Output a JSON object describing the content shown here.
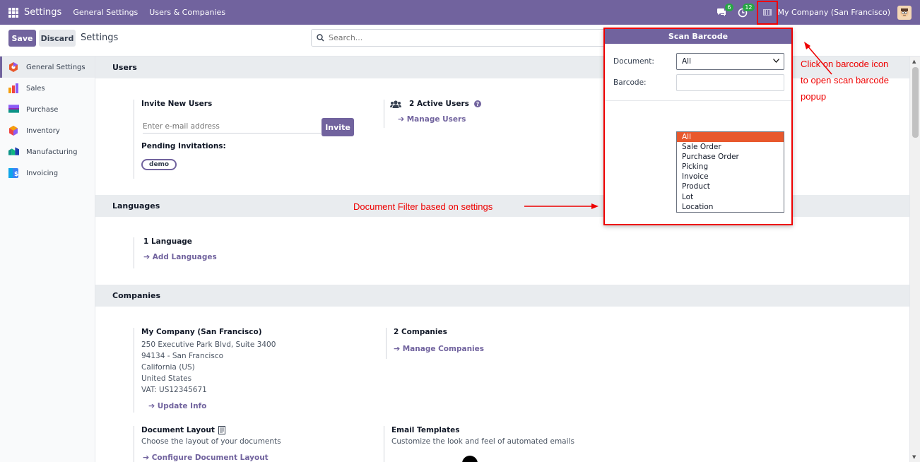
{
  "topbar": {
    "brand": "Settings",
    "nav": [
      "General Settings",
      "Users & Companies"
    ],
    "chat_badge": "6",
    "activity_badge": "12",
    "company": "My Company (San Francisco)"
  },
  "controlbar": {
    "save": "Save",
    "discard": "Discard",
    "title": "Settings",
    "search_placeholder": "Search..."
  },
  "sidebar": {
    "items": [
      {
        "label": "General Settings",
        "color": "#e8582c"
      },
      {
        "label": "Sales",
        "color": "#f59e0b"
      },
      {
        "label": "Purchase",
        "color": "#8b5cf6"
      },
      {
        "label": "Inventory",
        "color": "#ef4444"
      },
      {
        "label": "Manufacturing",
        "color": "#10b981"
      },
      {
        "label": "Invoicing",
        "color": "#3b82f6"
      }
    ]
  },
  "users": {
    "section": "Users",
    "invite_title": "Invite New Users",
    "email_placeholder": "Enter e-mail address",
    "invite_button": "Invite",
    "pending_title": "Pending Invitations:",
    "pending_user": "demo",
    "active_users": "2 Active Users",
    "manage_users": "Manage Users"
  },
  "languages": {
    "section": "Languages",
    "count": "1 Language",
    "add": "Add Languages"
  },
  "companies": {
    "section": "Companies",
    "company_name": "My Company (San Francisco)",
    "address_lines": [
      "250 Executive Park Blvd, Suite 3400",
      "94134 - San Francisco",
      "California (US)",
      "United States",
      "VAT:  US12345671"
    ],
    "update_info": "Update Info",
    "count": "2 Companies",
    "manage": "Manage Companies",
    "doc_layout_title": "Document Layout",
    "doc_layout_desc": "Choose the layout of your documents",
    "doc_layout_link": "Configure Document Layout",
    "email_title": "Email Templates",
    "email_desc": "Customize the look and feel of automated emails"
  },
  "popup": {
    "title": "Scan Barcode",
    "document_label": "Document:",
    "document_value": "All",
    "barcode_label": "Barcode:",
    "options": [
      "All",
      "Sale Order",
      "Purchase Order",
      "Picking",
      "Invoice",
      "Product",
      "Lot",
      "Location"
    ]
  },
  "annotations": {
    "barcode_note": [
      "Click on barcode icon",
      "to open scan barcode",
      "popup"
    ],
    "filter_note": "Document Filter based on  settings"
  }
}
